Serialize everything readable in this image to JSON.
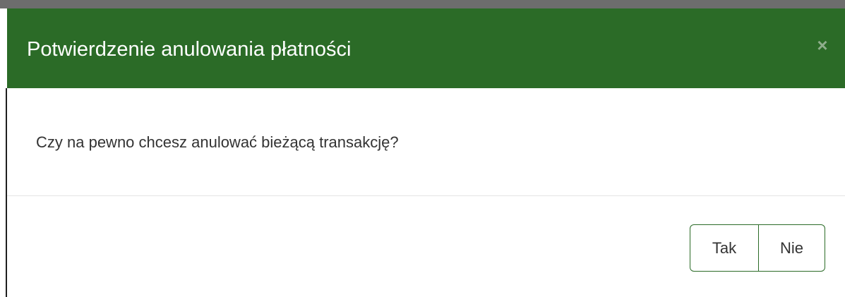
{
  "dialog": {
    "title": "Potwierdzenie anulowania płatności",
    "close_label": "×",
    "message": "Czy na pewno chcesz anulować bieżącą transakcję?",
    "buttons": {
      "yes_label": "Tak",
      "no_label": "Nie"
    }
  },
  "colors": {
    "header_bg": "#2b6b27",
    "button_border": "#2b6b27"
  }
}
